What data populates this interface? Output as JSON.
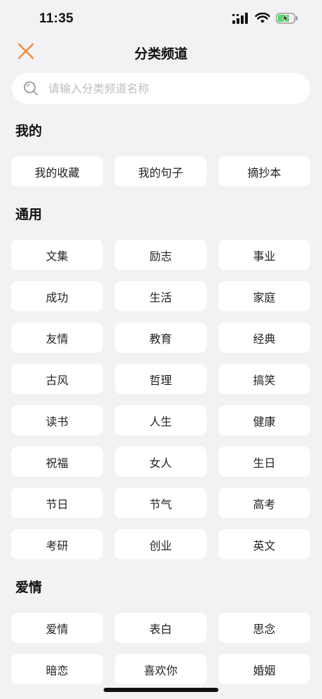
{
  "status_bar": {
    "time": "11:35"
  },
  "nav": {
    "title": "分类频道"
  },
  "search": {
    "placeholder": "请输入分类频道名称"
  },
  "sections": [
    {
      "title": "我的",
      "items": [
        "我的收藏",
        "我的句子",
        "摘抄本"
      ]
    },
    {
      "title": "通用",
      "items": [
        "文集",
        "励志",
        "事业",
        "成功",
        "生活",
        "家庭",
        "友情",
        "教育",
        "经典",
        "古风",
        "哲理",
        "搞笑",
        "读书",
        "人生",
        "健康",
        "祝福",
        "女人",
        "生日",
        "节日",
        "节气",
        "高考",
        "考研",
        "创业",
        "英文"
      ]
    },
    {
      "title": "爱情",
      "items": [
        "爱情",
        "表白",
        "思念",
        "暗恋",
        "喜欢你",
        "婚姻"
      ]
    }
  ],
  "colors": {
    "accent": "#f08a3c",
    "background": "#f2f2f4",
    "chip": "#ffffff"
  }
}
